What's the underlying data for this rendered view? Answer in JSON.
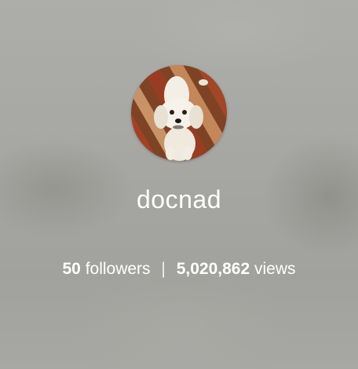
{
  "profile": {
    "avatar_icon": "dog-photo-avatar",
    "username": "docnad",
    "followers_count": "50",
    "followers_label": "followers",
    "separator": "|",
    "views_count": "5,020,862",
    "views_label": "views"
  },
  "colors": {
    "background": "#a7a7a2",
    "text": "#ffffff"
  }
}
